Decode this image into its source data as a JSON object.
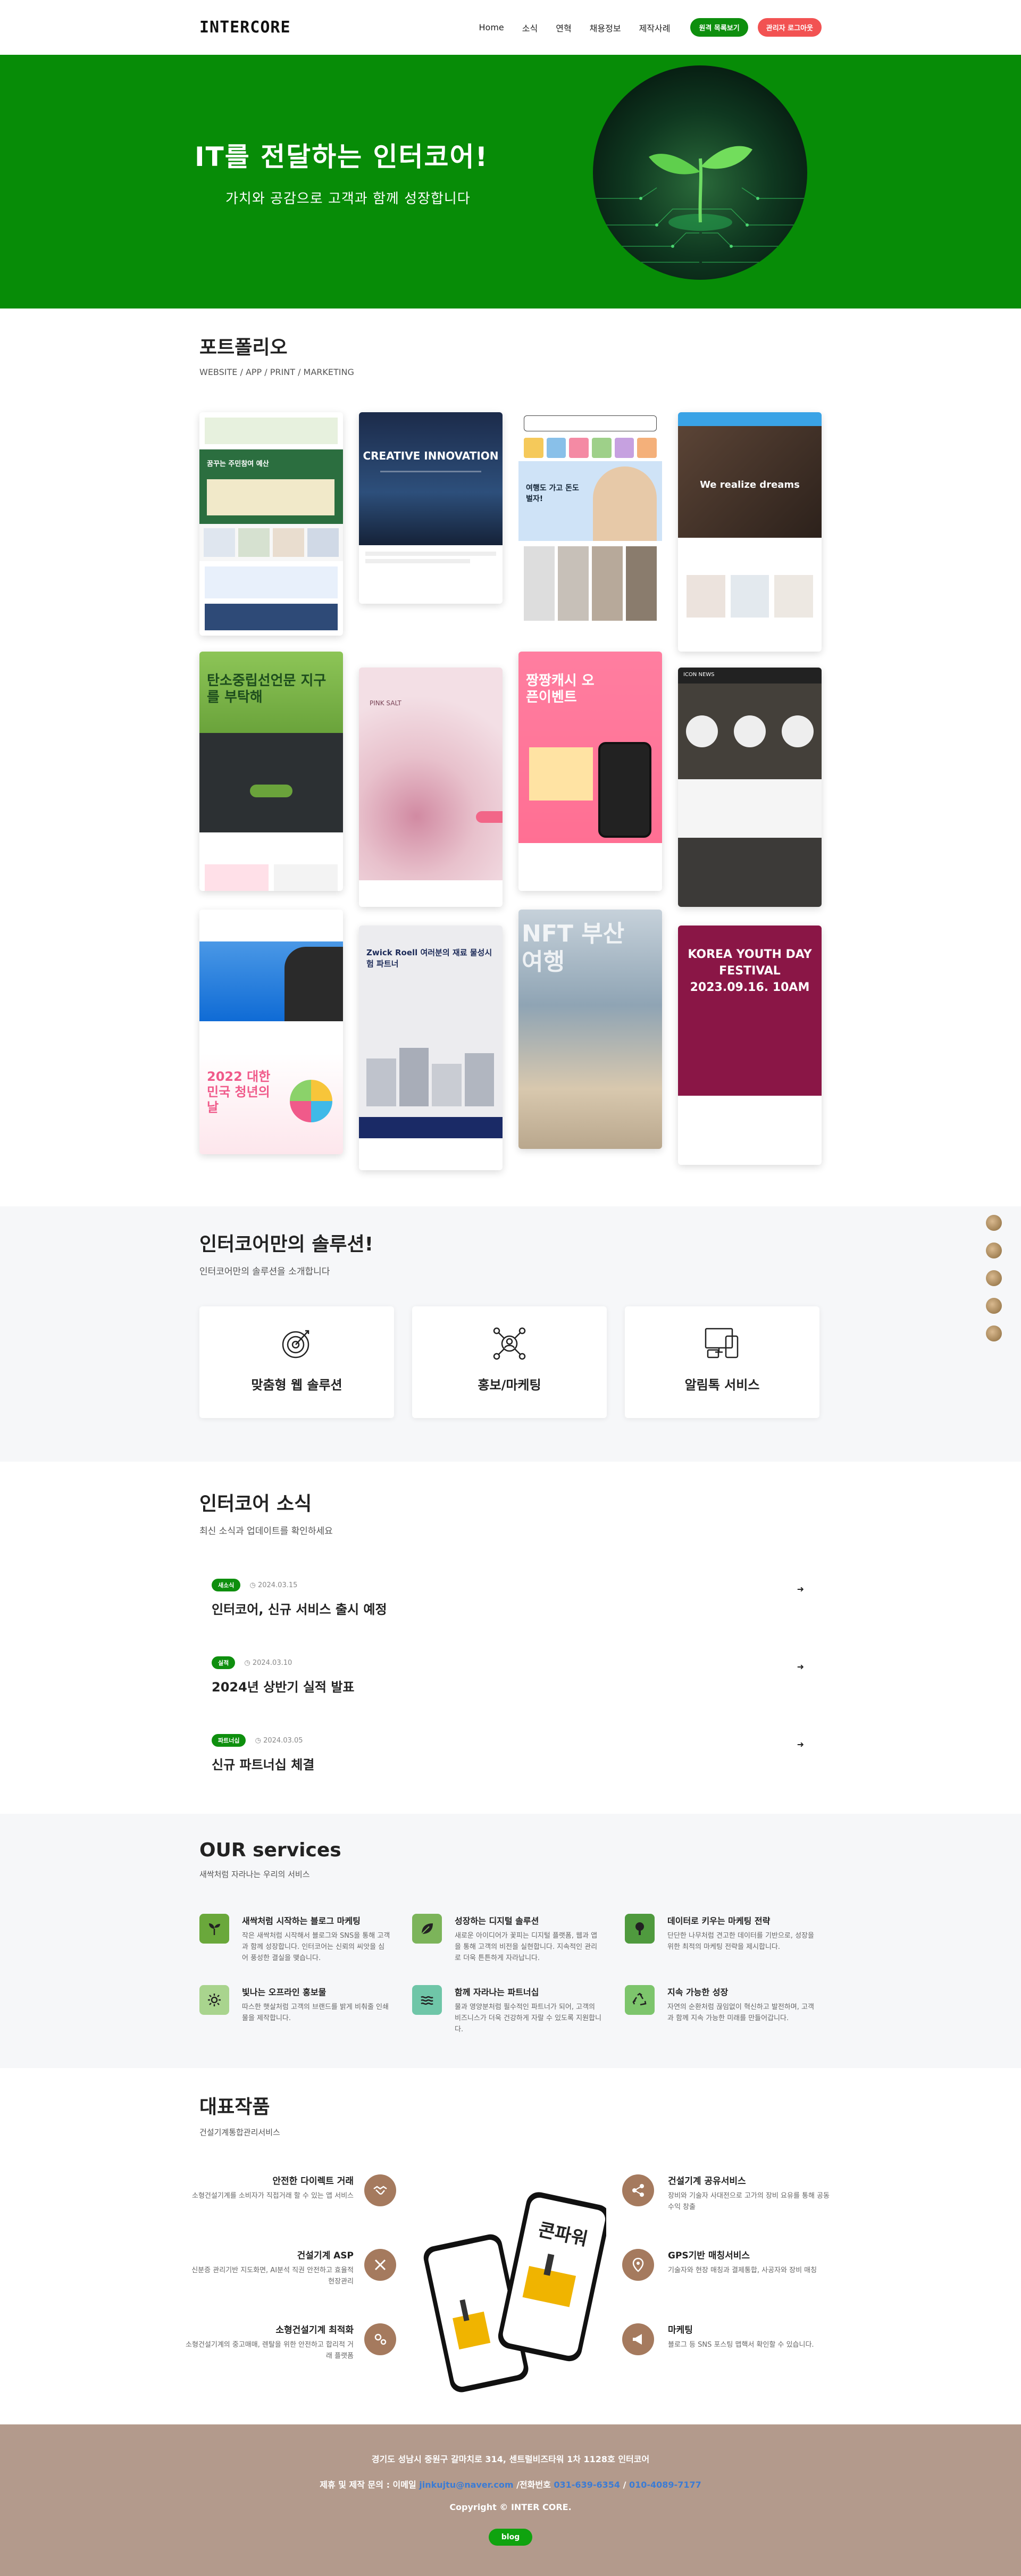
{
  "header": {
    "logo": "INTERCORE",
    "nav": [
      "Home",
      "소식",
      "연혁",
      "채용정보",
      "제작사례"
    ],
    "btn_portfolio": "원격 목록보기",
    "btn_admin": "관리자 로그아웃"
  },
  "hero": {
    "title": "IT를 전달하는 인터코어!",
    "subtitle": "가치와 공감으로 고객과 함께 성장합니다"
  },
  "portfolio": {
    "title": "포트폴리오",
    "subtitle": "WEBSITE / APP / PRINT / MARKETING",
    "cards": [
      {
        "label": "꿈꾸는 주민참여 예산",
        "theme": "#2b6e3f",
        "accent": "#e9f0e2"
      },
      {
        "label": "CREATIVE INNOVATION",
        "theme": "#1d2c47",
        "accent": "#ffffff"
      },
      {
        "label": "여행도 가고 돈도 벌자!",
        "theme": "#4a7fd1",
        "accent": "#f1f4f8"
      },
      {
        "label": "We realize dreams",
        "theme": "#3b2c26",
        "accent": "#ffffff"
      },
      {
        "label": "탄소중립선언문 지구를 부탁해",
        "theme": "#6aa33b",
        "accent": "#2c3033"
      },
      {
        "label": "PINK SALT",
        "theme": "#e4b2be",
        "accent": "#ffffff"
      },
      {
        "label": "짱짱캐시 오픈이벤트",
        "theme": "#ff6f93",
        "accent": "#ffffff"
      },
      {
        "label": "ICON NEWS",
        "theme": "#44403a",
        "accent": "#ffffff"
      },
      {
        "label": "2022 대한민국 청년의날",
        "theme": "#0f6bd5",
        "accent": "#ffffff"
      },
      {
        "label": "Zwick Roell 여러분의 재료 물성시험 파트너",
        "theme": "#e8e8ec",
        "accent": "#1c2a58"
      },
      {
        "label": "NFT 부산여행",
        "theme": "#a7b6c2",
        "accent": "#ffffff"
      },
      {
        "label": "KOREA YOUTH DAY FESTIVAL 2023.09.16. 10AM",
        "theme": "#8a1646",
        "accent": "#ffffff"
      }
    ]
  },
  "solutions": {
    "title": "인터코어만의 솔루션!",
    "subtitle": "인터코어만의 솔루션을 소개합니다",
    "items": [
      "맞춤형 웹 솔루션",
      "홍보/마케팅",
      "알림톡 서비스"
    ]
  },
  "news": {
    "title": "인터코어 소식",
    "subtitle": "최신 소식과 업데이트를 확인하세요",
    "items": [
      {
        "badge": "새소식",
        "date": "2024.03.15",
        "title": "인터코어, 신규 서비스 출시 예정"
      },
      {
        "badge": "실적",
        "date": "2024.03.10",
        "title": "2024년 상반기 실적 발표"
      },
      {
        "badge": "파트너십",
        "date": "2024.03.05",
        "title": "신규 파트너십 체결"
      }
    ]
  },
  "services": {
    "title": "OUR services",
    "subtitle": "새싹처럼 자라나는 우리의 서비스",
    "items": [
      {
        "title": "새싹처럼 시작하는 블로그 마케팅",
        "desc": "작은 새싹처럼 시작해서 블로그와 SNS을 통해 고객과 함께 성장합니다. 인터코어는 신뢰의 씨앗을 심어 풍성한 결실을 맺습니다.",
        "color": "#6aa83b",
        "icon": "seedling-icon"
      },
      {
        "title": "성장하는 디지털 솔루션",
        "desc": "새로운 아이디어가 꽃피는 디지털 플랫폼, 웹과 앱을 통해 고객의 비전을 실현합니다. 지속적인 관리로 더욱 튼튼하게 자라납니다.",
        "color": "#7cb45a",
        "icon": "leaf-icon"
      },
      {
        "title": "데이터로 키우는 마케팅 전략",
        "desc": "단단한 나무처럼 견고한 데이터를 기반으로, 성장을 위한 최적의 마케팅 전략을 제시합니다.",
        "color": "#4f9a3e",
        "icon": "tree-icon"
      },
      {
        "title": "빛나는 오프라인 홍보물",
        "desc": "따스한 햇살처럼 고객의 브랜드를 밝게 비춰줄 인쇄물을 제작합니다.",
        "color": "#a9d48e",
        "icon": "sun-icon"
      },
      {
        "title": "함께 자라나는 파트너십",
        "desc": "물과 영양분처럼 필수적인 파트너가 되어, 고객의 비즈니스가 더욱 건강하게 자랄 수 있도록 지원합니다.",
        "color": "#6fc6a8",
        "icon": "water-icon"
      },
      {
        "title": "지속 가능한 성장",
        "desc": "자연의 순환처럼 끊임없이 혁신하고 발전하며, 고객과 함께 지속 가능한 미래를 만들어갑니다.",
        "color": "#7dc56c",
        "icon": "recycle-icon"
      }
    ]
  },
  "works": {
    "title": "대표작품",
    "subtitle": "건설기계통합관리서비스",
    "left": [
      {
        "title": "안전한 다이렉트 거래",
        "desc": "소형건설기계를 소비자가 직접거래 할 수 있는 앱 서비스",
        "icon": "handshake-icon"
      },
      {
        "title": "건설기계 ASP",
        "desc": "신분증 관리기반 지도화면, AI분석 직권 안전하고 효율적 현장관리",
        "icon": "tools-icon"
      },
      {
        "title": "소형건설기계 최적화",
        "desc": "소형건설기계의 중고매매, 렌탈을 위한 안전하고 합리적 거래 플랫폼",
        "icon": "gears-icon"
      }
    ],
    "right": [
      {
        "title": "건설기계 공유서비스",
        "desc": "장비와 기술자 사대전으로 고가의 장비 요유를 통해 공동 수익 창출",
        "icon": "share-icon"
      },
      {
        "title": "GPS기반 매칭서비스",
        "desc": "기술자와 현장 매칭과 결제통합, 사공자와 장비 매칭",
        "icon": "location-icon"
      },
      {
        "title": "마케팅",
        "desc": "블로그 등 SNS 포스팅 맵핵서 확인할 수 있습니다.",
        "icon": "megaphone-icon"
      }
    ],
    "phone_label": "콘파워"
  },
  "footer": {
    "address": "경기도 성남시 중원구 갈마치로 314, 센트럴비즈타워 1차 1128호 인터코어",
    "contact_prefix": "제휴 및 제작 문의 : 이메일",
    "email": "jinkujtu@naver.com",
    "phone_prefix": "/전화번호",
    "phone1": "031-639-6354",
    "phone2": "010-4089-7177",
    "copyright": "Copyright © INTER CORE.",
    "blog": "blog"
  },
  "colors": {
    "brand_green": "#078c07",
    "accent_red": "#f25252",
    "footer_bg": "#b39a8c",
    "work_icon": "#a57a5e"
  }
}
